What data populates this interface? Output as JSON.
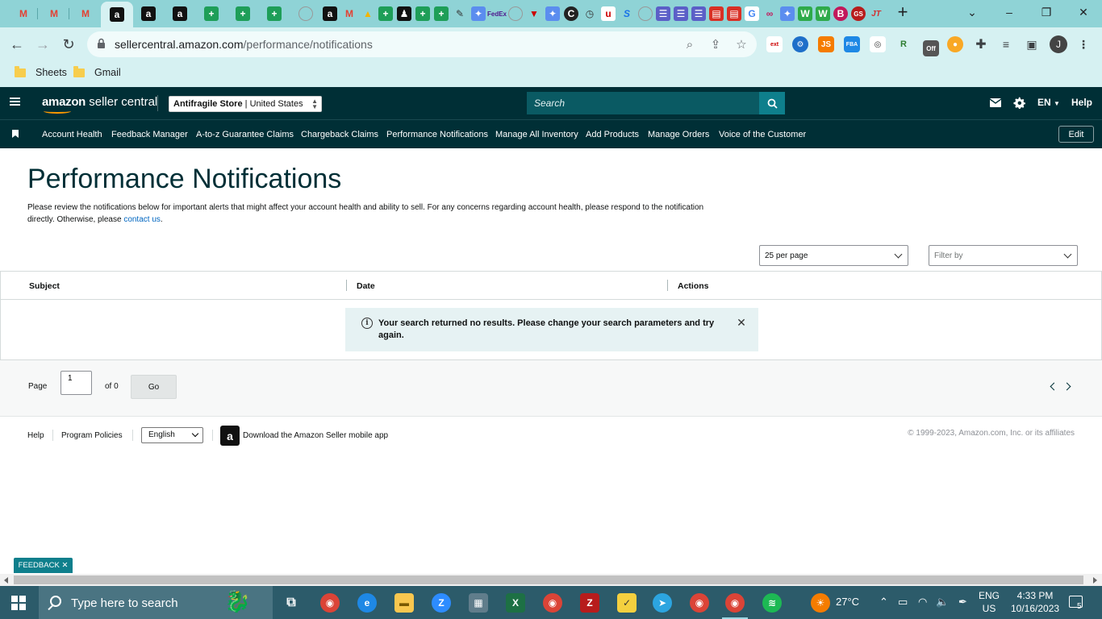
{
  "browser": {
    "url_host": "sellercentral.amazon.com",
    "url_path": "/performance/notifications",
    "profile_initial": "J",
    "bookmarks": [
      "Sheets",
      "Gmail"
    ],
    "extension_badge": "Off"
  },
  "header": {
    "brand_bold": "amazon",
    "brand_rest": " seller central",
    "store_name": "Antifragile Store",
    "store_region": "United States",
    "search_placeholder": "Search",
    "language": "EN",
    "help": "Help"
  },
  "nav": {
    "links": [
      "Account Health",
      "Feedback Manager",
      "A-to-z Guarantee Claims",
      "Chargeback Claims",
      "Performance Notifications",
      "Manage All Inventory",
      "Add Products",
      "Manage Orders",
      "Voice of the Customer"
    ],
    "edit": "Edit"
  },
  "main": {
    "title": "Performance Notifications",
    "intro": "Please review the notifications below for important alerts that might affect your account health and ability to sell. For any concerns regarding account health, please respond to the notification directly. Otherwise, please ",
    "intro_link": "contact us",
    "intro_end": ".",
    "per_page": "25 per page",
    "filter_placeholder": "Filter by",
    "columns": [
      "Subject",
      "Date",
      "Actions"
    ],
    "empty_message": "Your search returned no results. Please change your search parameters and try again."
  },
  "pager": {
    "page_label": "Page",
    "page_value": "1",
    "of_label": "of 0",
    "go": "Go"
  },
  "footer": {
    "help": "Help",
    "policies": "Program Policies",
    "language": "English",
    "app_text": "Download the Amazon Seller mobile app",
    "copyright": "© 1999-2023, Amazon.com, Inc. or its affiliates",
    "feedback": "FEEDBACK"
  },
  "taskbar": {
    "search_text": "Type here to search",
    "weather": "27°C",
    "lang_top": "ENG",
    "lang_bottom": "US",
    "time": "4:33 PM",
    "date": "10/16/2023",
    "notification_count": "5"
  },
  "colors": {
    "header_bg": "#002f36",
    "search_bg": "#0a5a63",
    "accent": "#0e7f8c",
    "chrome_frame": "#8fd3d6"
  }
}
